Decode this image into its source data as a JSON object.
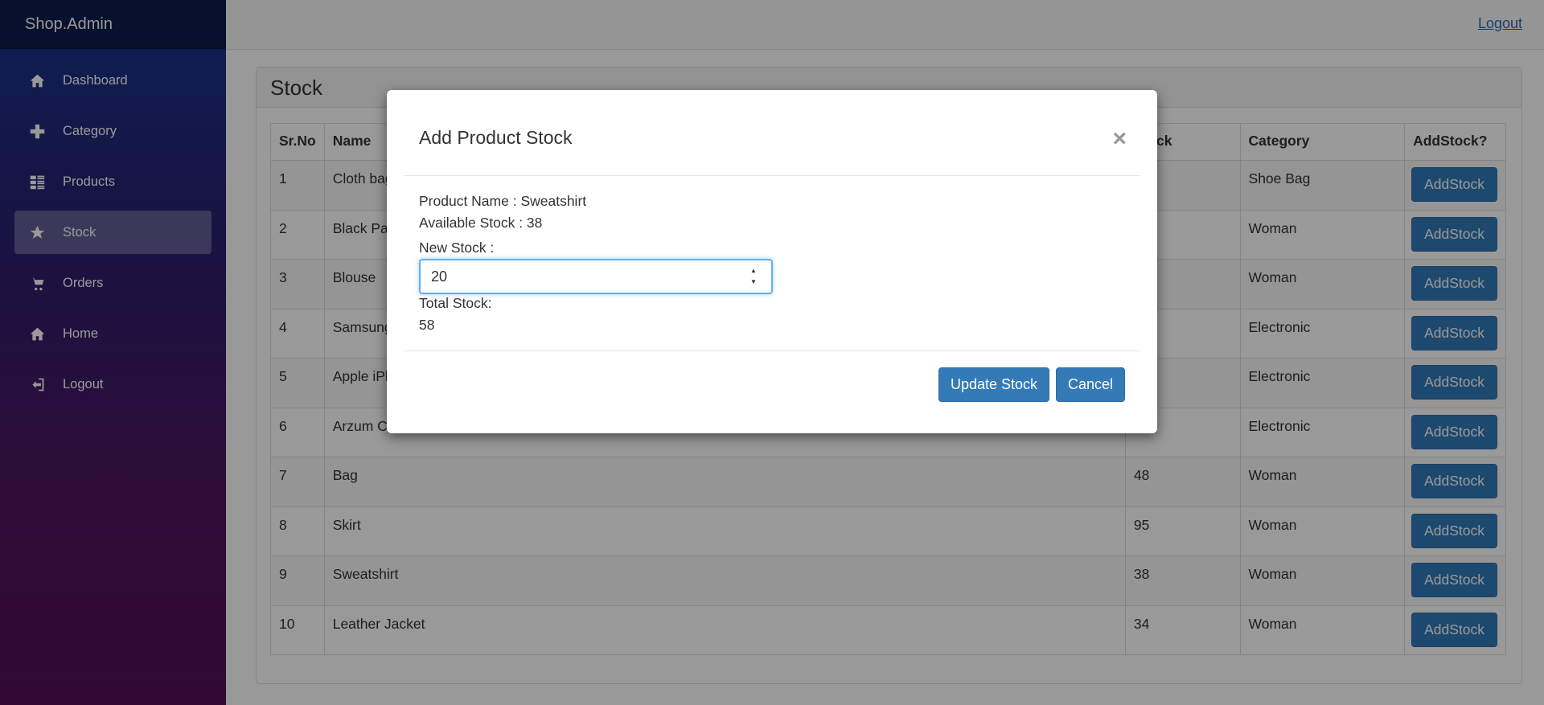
{
  "brand": "Shop.Admin",
  "nav": [
    {
      "label": "Dashboard",
      "icon": "home-icon"
    },
    {
      "label": "Category",
      "icon": "plus-icon"
    },
    {
      "label": "Products",
      "icon": "list-icon"
    },
    {
      "label": "Stock",
      "icon": "star-icon"
    },
    {
      "label": "Orders",
      "icon": "cart-icon"
    },
    {
      "label": "Home",
      "icon": "home-icon"
    },
    {
      "label": "Logout",
      "icon": "logout-icon"
    }
  ],
  "topbar": {
    "logout": "Logout"
  },
  "panel": {
    "title": "Stock"
  },
  "table": {
    "headers": [
      "Sr.No",
      "Name",
      "Stock",
      "Category",
      "AddStock?"
    ],
    "button_label": "AddStock",
    "rows": [
      {
        "no": "1",
        "name": "Cloth bag",
        "stock": "",
        "category": "Shoe Bag"
      },
      {
        "no": "2",
        "name": "Black Pants",
        "stock": "",
        "category": "Woman"
      },
      {
        "no": "3",
        "name": "Blouse",
        "stock": "",
        "category": "Woman"
      },
      {
        "no": "4",
        "name": "Samsung",
        "stock": "",
        "category": "Electronic"
      },
      {
        "no": "5",
        "name": "Apple iPhone",
        "stock": "",
        "category": "Electronic"
      },
      {
        "no": "6",
        "name": "Arzum Cooker",
        "stock": "",
        "category": "Electronic"
      },
      {
        "no": "7",
        "name": "Bag",
        "stock": "48",
        "category": "Woman"
      },
      {
        "no": "8",
        "name": "Skirt",
        "stock": "95",
        "category": "Woman"
      },
      {
        "no": "9",
        "name": "Sweatshirt",
        "stock": "38",
        "category": "Woman"
      },
      {
        "no": "10",
        "name": "Leather Jacket",
        "stock": "34",
        "category": "Woman"
      }
    ]
  },
  "modal": {
    "title": "Add Product Stock",
    "close": "×",
    "product_name": "Product Name : Sweatshirt",
    "available_stock": "Available Stock : 38",
    "new_stock_label": "New Stock :",
    "new_stock_value": "20",
    "total_stock_label": "Total Stock:",
    "total_stock_value": "58",
    "update_button": "Update Stock",
    "cancel_button": "Cancel"
  }
}
